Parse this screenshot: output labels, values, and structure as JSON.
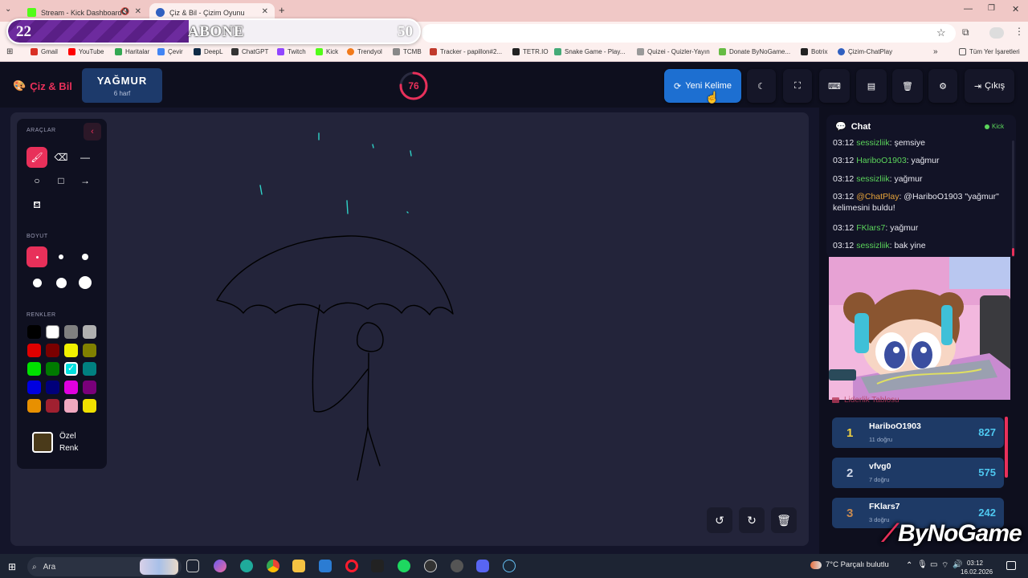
{
  "browser": {
    "tabs": [
      {
        "title": "Stream - Kick Dashboard",
        "active": false
      },
      {
        "title": "Çiz & Bil - Çizim Oyunu",
        "active": true
      }
    ],
    "bookmarks": [
      "Gmail",
      "YouTube",
      "Haritalar",
      "Çevir",
      "DeepL",
      "ChatGPT",
      "Twitch",
      "Kick",
      "Trendyol",
      "TCMB",
      "Tracker - papillon#2...",
      "TETR.IO",
      "Snake Game - Play...",
      "Quizei - Quizler-Yayın",
      "Donate ByNoGame...",
      "Botrix",
      "Çizim-ChatPlay"
    ],
    "all_bookmarks": "Tüm Yer İşaretleri"
  },
  "sub_goal": {
    "current": "22",
    "label": "ABONE",
    "goal": "50",
    "progress_percent": 44
  },
  "app": {
    "logo": "Çiz & Bil",
    "word": "YAĞMUR",
    "word_hint": "6 harf",
    "timer": "76",
    "new_word_label": "Yeni Kelime",
    "exit_label": "Çıkış"
  },
  "tools": {
    "sections": {
      "tools": "ARAÇLAR",
      "size": "BOYUT",
      "colors": "RENKLER"
    },
    "custom_color_label": "Özel Renk",
    "palette": [
      "#000000",
      "#ffffff",
      "#808080",
      "#b0b0b0",
      "#e00000",
      "#7a0000",
      "#f0f000",
      "#808000",
      "#00e000",
      "#007a00",
      "#00e0e0",
      "#008080",
      "#0000e0",
      "#00007a",
      "#e000e0",
      "#7a007a",
      "#e89000",
      "#a02030",
      "#f0a8c0",
      "#f0e000"
    ],
    "selected_color": "#00e0e0"
  },
  "chat": {
    "title": "Chat",
    "source": "Kick",
    "messages": [
      {
        "time": "03:12",
        "user": "sessizliik",
        "text": ": şemsiye"
      },
      {
        "time": "03:12",
        "user": "HariboO1903",
        "text": ": yağmur"
      },
      {
        "time": "03:12",
        "user": "sessizliik",
        "text": ": yağmur"
      },
      {
        "time": "03:12",
        "user": "@ChatPlay",
        "text": ": @HariboO1903 \"yağmur\" kelimesini buldu!"
      },
      {
        "time": "03:12",
        "user": "FKlars7",
        "text": ": yağmur"
      },
      {
        "time": "03:12",
        "user": "sessizliik",
        "text": ": bak yine"
      }
    ]
  },
  "leaderboard": {
    "title": "Liderlik Tablosu",
    "rows": [
      {
        "rank": "1",
        "name": "HariboO1903",
        "count": "11 doğru",
        "points": "827"
      },
      {
        "rank": "2",
        "name": "vfvg0",
        "count": "7 doğru",
        "points": "575"
      },
      {
        "rank": "3",
        "name": "FKlars7",
        "count": "3 doğru",
        "points": "242"
      }
    ]
  },
  "watermark": "ByNoGame",
  "taskbar": {
    "search": "Ara",
    "weather": "7°C  Parçalı bulutlu",
    "time": "03:12",
    "date": "16.02.2026"
  }
}
